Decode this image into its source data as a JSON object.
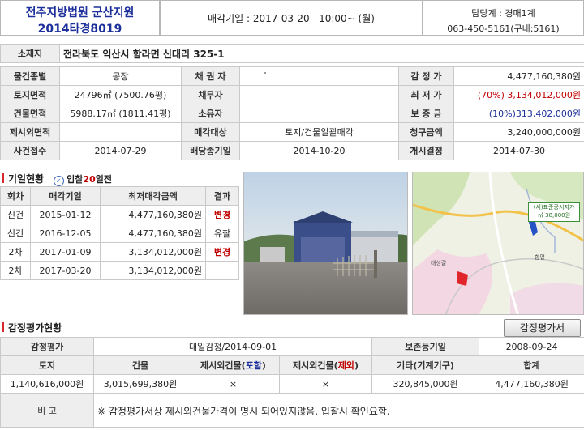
{
  "header": {
    "court": "전주지방법원 군산지원",
    "case_no": "2014타경8019",
    "sale_date": "매각기일 : 2017-03-20   10:00~ (월)",
    "dept": "담당계 : 경매1계",
    "phone": "063-450-5161(구내:5161)"
  },
  "property": {
    "location_label": "소재지",
    "location": "전라북도 익산시 함라면 신대리 325-1",
    "rows": [
      [
        "물건종별",
        "공장",
        "채 권 자",
        "",
        "감 정 가",
        "4,477,160,380원"
      ],
      [
        "토지면적",
        "24796㎡ (7500.76평)",
        "채무자",
        "",
        "최 저 가",
        "(70%) 3,134,012,000원"
      ],
      [
        "건물면적",
        "5988.17㎡ (1811.41평)",
        "소유자",
        "",
        "보 증 금",
        "(10%)313,402,000원"
      ],
      [
        "제시외면적",
        "",
        "매각대상",
        "토지/건물일괄매각",
        "청구금액",
        "3,240,000,000원"
      ],
      [
        "사건접수",
        "2014-07-29",
        "배당종기일",
        "2014-10-20",
        "개시결정",
        "2014-07-30"
      ]
    ]
  },
  "history": {
    "title": "기일현황",
    "bid_info_prefix": "입찰",
    "bid_info_days": "20",
    "bid_info_suffix": "일전",
    "columns": [
      "회차",
      "매각기일",
      "최저매각금액",
      "결과"
    ],
    "rows": [
      [
        "신건",
        "2015-01-12",
        "4,477,160,380원",
        "변경"
      ],
      [
        "신건",
        "2016-12-05",
        "4,477,160,380원",
        "유찰"
      ],
      [
        "2차",
        "2017-01-09",
        "3,134,012,000원",
        "변경"
      ],
      [
        "2차",
        "2017-03-20",
        "3,134,012,000원",
        ""
      ]
    ]
  },
  "map": {
    "price_label": "(서)표준공시지가",
    "price_value": "㎡ 38,000원",
    "place1": "대성갈",
    "place2": "함열"
  },
  "appraisal": {
    "title": "감정평가현황",
    "button": "감정평가서",
    "row1": [
      "감정평가",
      "대일감정/2014-09-01",
      "보존등기일",
      "2008-09-24"
    ],
    "columns": [
      "토지",
      "건물",
      "제시외건물(",
      "포함",
      ")",
      "제시외건물(",
      "제외",
      ")",
      "기타(기계기구)",
      "합계"
    ],
    "values": [
      "1,140,616,000원",
      "3,015,699,380원",
      "×",
      "×",
      "320,845,000원",
      "4,477,160,380원"
    ],
    "note_label": "비 고",
    "note": "※ 감정평가서상 제시외건물가격이 명시 되어있지않음. 입찰시 확인요함."
  },
  "colors": {
    "accent_blue": "#1c2f9b",
    "accent_red": "#c00000",
    "label_bg": "#eeeeee"
  }
}
